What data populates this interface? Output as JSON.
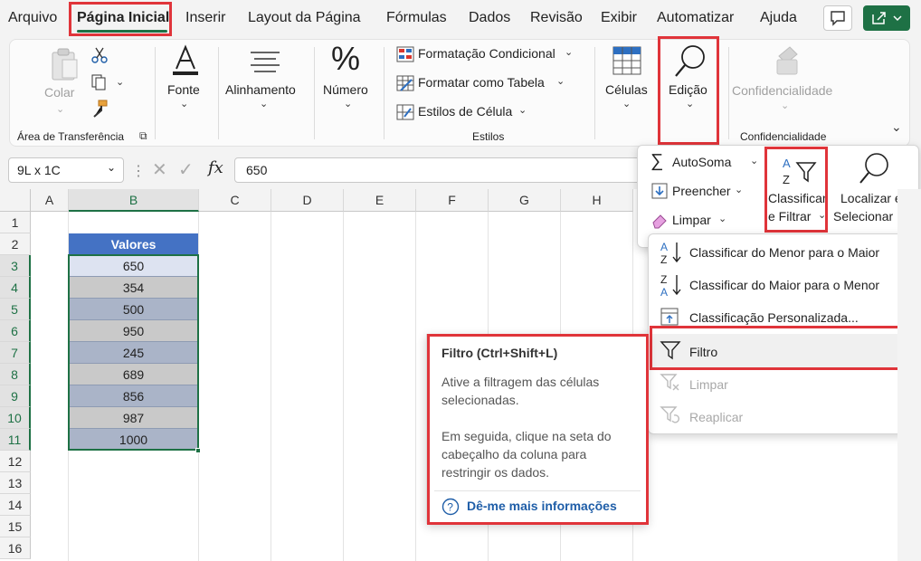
{
  "menubar": {
    "tabs": [
      "Arquivo",
      "Página Inicial",
      "Inserir",
      "Layout da Página",
      "Fórmulas",
      "Dados",
      "Revisão",
      "Exibir",
      "Automatizar",
      "Ajuda"
    ],
    "active_tab": "Página Inicial"
  },
  "ribbon": {
    "clipboard": {
      "paste_label": "Colar",
      "group_label": "Área de Transferência"
    },
    "font_label": "Fonte",
    "alignment_label": "Alinhamento",
    "number_label": "Número",
    "styles": {
      "items": [
        "Formatação Condicional",
        "Formatar como Tabela",
        "Estilos de Célula"
      ],
      "group_label": "Estilos"
    },
    "cells_label": "Células",
    "editing_label": "Edição",
    "sensitivity": {
      "button_label": "Confidencialidade",
      "group_label": "Confidencialidade"
    }
  },
  "formula_bar": {
    "name_box": "9L x 1C",
    "fx": "fx",
    "value": "650"
  },
  "grid": {
    "columns": [
      "A",
      "B",
      "C",
      "D",
      "E",
      "F",
      "G",
      "H"
    ],
    "rows": [
      "1",
      "2",
      "3",
      "4",
      "5",
      "6",
      "7",
      "8",
      "9",
      "10",
      "11",
      "12",
      "13",
      "14",
      "15",
      "16"
    ],
    "header": "Valores",
    "values": [
      "650",
      "354",
      "500",
      "950",
      "245",
      "689",
      "856",
      "987",
      "1000"
    ]
  },
  "editing_menu": {
    "autosum": "AutoSoma",
    "fill": "Preencher",
    "clear": "Limpar",
    "sort_filter": [
      "Classificar",
      "e Filtrar"
    ],
    "find_select": [
      "Localizar e",
      "Selecionar"
    ]
  },
  "sort_menu": {
    "items": [
      {
        "label": "Classificar do Menor para o Maior",
        "enabled": true
      },
      {
        "label": "Classificar do Maior para o Menor",
        "enabled": true
      },
      {
        "label": "Classificação Personalizada...",
        "enabled": true
      },
      {
        "label": "Filtro",
        "enabled": true
      },
      {
        "label": "Limpar",
        "enabled": false
      },
      {
        "label": "Reaplicar",
        "enabled": false
      }
    ]
  },
  "tooltip": {
    "title": "Filtro (Ctrl+Shift+L)",
    "para1": "Ative a filtragem das células selecionadas.",
    "para2": "Em seguida, clique na seta do cabeçalho da coluna para restringir os dados.",
    "link": "Dê-me mais informações"
  },
  "colors": {
    "accent": "#1e7145",
    "highlight": "#e0343a",
    "table_header": "#4472c4",
    "row_light": "#cfd8ec",
    "row_dark": "#aab4c8"
  }
}
